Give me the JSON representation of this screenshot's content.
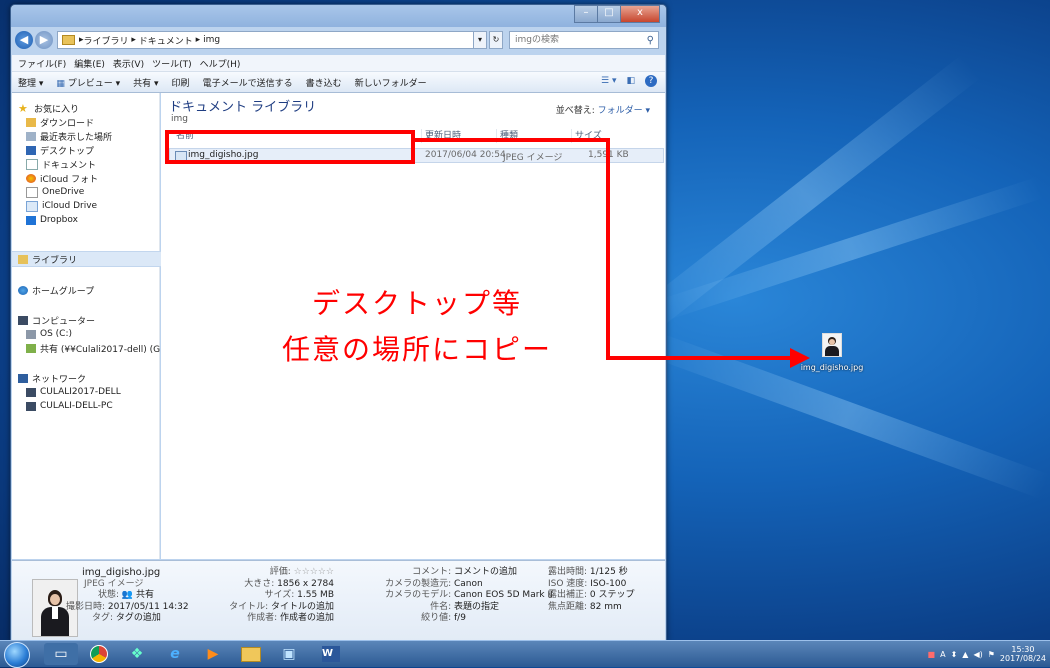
{
  "window": {
    "address_crumbs": [
      "ライブラリ",
      "ドキュメント",
      "img"
    ],
    "search_placeholder": "imgの検索",
    "caption_buttons": [
      "–",
      "□",
      "x"
    ],
    "menu": [
      "ファイル(F)",
      "編集(E)",
      "表示(V)",
      "ツール(T)",
      "ヘルプ(H)"
    ],
    "toolbar": {
      "organize": "整理 ▾",
      "preview": "プレビュー ▾",
      "share": "共有 ▾",
      "print": "印刷",
      "email": "電子メールで送信する",
      "burn": "書き込む",
      "new_folder": "新しいフォルダー"
    }
  },
  "nav": {
    "favorites_header": "お気に入り",
    "favorites": [
      "ダウンロード",
      "最近表示した場所",
      "デスクトップ",
      "ドキュメント",
      "iCloud フォト",
      "OneDrive",
      "iCloud Drive",
      "Dropbox"
    ],
    "libraries": "ライブラリ",
    "homegroup": "ホームグループ",
    "computer": "コンピューター",
    "drives": [
      "OS (C:)",
      "共有 (¥¥Culali2017-dell) (G:)"
    ],
    "network": "ネットワーク",
    "network_items": [
      "CULALI2017-DELL",
      "CULALI-DELL-PC"
    ]
  },
  "content": {
    "library_title": "ドキュメント ライブラリ",
    "library_subtitle": "img",
    "sort_label": "並べ替え:",
    "sort_value": "フォルダー ▾",
    "columns": [
      "名前",
      "更新日時",
      "種類",
      "サイズ"
    ],
    "file": {
      "name": "img_digisho.jpg",
      "modified": "2017/06/04 20:54",
      "type": "JPEG イメージ",
      "size": "1,591 KB"
    }
  },
  "details": {
    "filename": "img_digisho.jpg",
    "filetype": "JPEG イメージ",
    "col1": [
      {
        "label": "状態:",
        "value": "共有"
      },
      {
        "label": "撮影日時:",
        "value": "2017/05/11 14:32"
      },
      {
        "label": "タグ:",
        "value": "タグの追加"
      }
    ],
    "col2": [
      {
        "label": "評価:",
        "value": "☆☆☆☆☆"
      },
      {
        "label": "大きさ:",
        "value": "1856 x 2784"
      },
      {
        "label": "サイズ:",
        "value": "1.55 MB"
      },
      {
        "label": "タイトル:",
        "value": "タイトルの追加"
      },
      {
        "label": "作成者:",
        "value": "作成者の追加"
      }
    ],
    "col3": [
      {
        "label": "コメント:",
        "value": "コメントの追加"
      },
      {
        "label": "カメラの製造元:",
        "value": "Canon"
      },
      {
        "label": "カメラのモデル:",
        "value": "Canon EOS 5D Mark II"
      },
      {
        "label": "件名:",
        "value": "表題の指定"
      },
      {
        "label": "絞り値:",
        "value": "f/9"
      }
    ],
    "col4": [
      {
        "label": "露出時間:",
        "value": "1/125 秒"
      },
      {
        "label": "ISO 速度:",
        "value": "ISO-100"
      },
      {
        "label": "露出補正:",
        "value": "0 ステップ"
      },
      {
        "label": "焦点距離:",
        "value": "82 mm"
      }
    ]
  },
  "annotation": {
    "line1": "デスクトップ等",
    "line2": "任意の場所にコピー"
  },
  "desktop_icon": {
    "label": "img_digisho.jpg"
  },
  "taskbar": {
    "time": "15:30",
    "date": "2017/08/24"
  },
  "colors": {
    "annotation": "#ff0000",
    "title_blue": "#1f3d82"
  }
}
